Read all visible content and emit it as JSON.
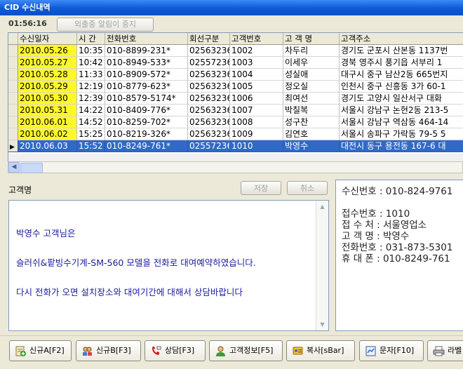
{
  "window": {
    "title": "CID 수신내역"
  },
  "toolbar": {
    "clock": "01:56:16",
    "mute_label": "외출중 알림이 중지"
  },
  "table": {
    "headers": [
      "수신일자",
      "시 간",
      "전화번호",
      "회선구분",
      "고객번호",
      "고 객 명",
      "고객주소"
    ],
    "rows": [
      [
        "2010.05.26",
        "10:35",
        "010-8899-231*",
        "02563236",
        "1002",
        "차두리",
        "경기도 군포시 산본동 1137번"
      ],
      [
        "2010.05.27",
        "10:42",
        "010-8949-533*",
        "02557236",
        "1003",
        "이세우",
        "경북 영주시 풍기읍 서부리 1"
      ],
      [
        "2010.05.28",
        "11:33",
        "010-8909-572*",
        "02563236",
        "1004",
        "성실애",
        "대구시 중구 남산2동 665번지"
      ],
      [
        "2010.05.29",
        "12:19",
        "010-8779-623*",
        "02563236",
        "1005",
        "정오실",
        "인천시 중구 신흥동 3가 60-1"
      ],
      [
        "2010.05.30",
        "12:39",
        "010-8579-5174*",
        "02563236",
        "1006",
        "최여선",
        "경기도 고양시 일산서구 대화"
      ],
      [
        "2010.05.31",
        "14:22",
        "010-8409-776*",
        "02563236",
        "1007",
        "박칠복",
        "서울시 강남구 논현2동 213-5"
      ],
      [
        "2010.06.01",
        "14:52",
        "010-8259-702*",
        "02563236",
        "1008",
        "성구찬",
        "서울시 강남구 역삼동 464-14"
      ],
      [
        "2010.06.02",
        "15:25",
        "010-8219-326*",
        "02563236",
        "1009",
        "김연호",
        "서울시 송파구 가락동 79-5 5"
      ],
      [
        "2010.06.03",
        "15:52",
        "010-8249-761*",
        "02557236",
        "1010",
        "박영수",
        "대전시 동구 용전동 167-6 대"
      ]
    ],
    "selected_index": 8
  },
  "customer": {
    "label": "고객명",
    "save_label": "저장",
    "cancel_label": "취소",
    "memo_lines": [
      "박영수 고객님은",
      "슬러쉬&팥빙수기계-SM-560 모델을 전화로 대여예약하였습니다.",
      "다시 전화가 오면 설치장소와 대여기간에 대해서 상담바랍니다"
    ]
  },
  "info": {
    "lines": [
      "수신번호 : 010-824-9761",
      "접수번호 : 1010",
      "접 수 처 : 서울영업소",
      "고 객 명 : 박영수",
      "전화번호 : 031-873-5301",
      "휴 대 폰 : 010-8249-761"
    ]
  },
  "buttons": [
    {
      "label": "신규A[F2]",
      "icon": "new-customer-a-icon"
    },
    {
      "label": "신규B[F3]",
      "icon": "new-customer-b-icon"
    },
    {
      "label": "상담[F3]",
      "icon": "consult-phone-icon"
    },
    {
      "label": "고객정보[F5]",
      "icon": "customer-info-icon"
    },
    {
      "label": "복사[sBar]",
      "icon": "copy-icon"
    },
    {
      "label": "문자[F10]",
      "icon": "sms-icon"
    },
    {
      "label": "라벨",
      "icon": "label-print-icon"
    }
  ],
  "colors": {
    "title_bar": "#0a5ad8",
    "date_highlight": "#fff82a",
    "selection": "#3169c6",
    "memo_text": "#1a1aa0"
  }
}
